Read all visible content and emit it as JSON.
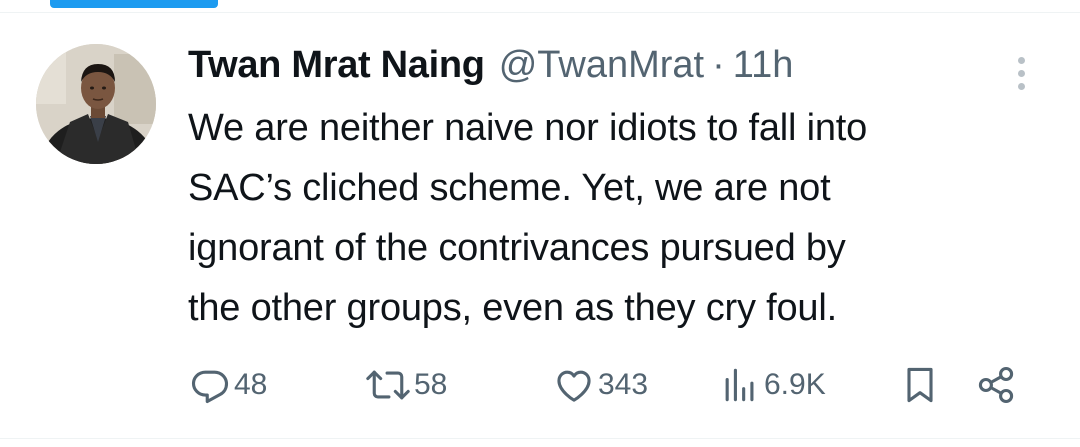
{
  "tweet": {
    "author": {
      "display_name": "Twan Mrat Naing",
      "handle": "@TwanMrat",
      "separator": "·",
      "time": "11h"
    },
    "text": "We are neither naive nor idiots to fall into\nSAC’s cliched scheme. Yet, we are not\nignorant of the contrivances pursued by\nthe other groups, even as they cry foul.",
    "stats": {
      "replies": "48",
      "retweets": "58",
      "likes": "343",
      "views": "6.9K"
    }
  },
  "icons": {
    "more": "more-vertical-icon",
    "reply": "reply-icon",
    "retweet": "retweet-icon",
    "like": "heart-icon",
    "views": "views-chart-icon",
    "bookmark": "bookmark-icon",
    "share": "share-icon"
  },
  "colors": {
    "accent": "#1d9bf0",
    "text_primary": "#0f1419",
    "text_secondary": "#536471",
    "divider": "#eff3f4"
  }
}
